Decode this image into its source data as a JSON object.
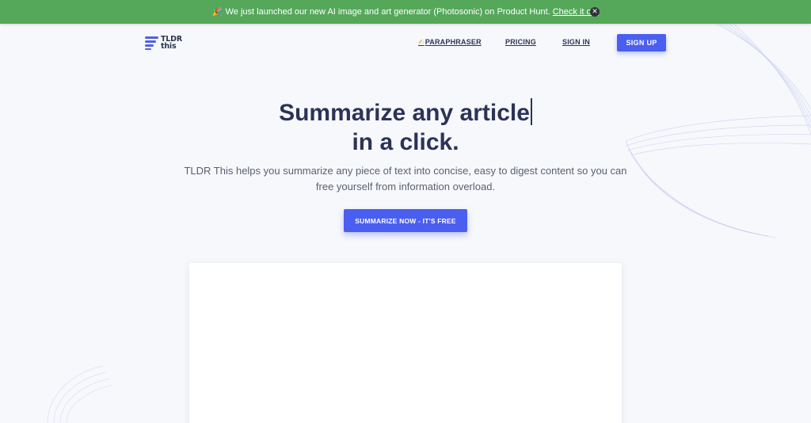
{
  "banner": {
    "emoji": "🎉",
    "text": "We just launched our new AI image and art generator (Photosonic) on Product Hunt.",
    "link_label": "Check it out",
    "close_glyph": "✕"
  },
  "logo": {
    "line1": "TLDR",
    "line2": "this",
    "icon": "lines-logo-icon",
    "color": "#5561d8"
  },
  "nav": {
    "paraphraser_icon": "✍",
    "paraphraser_label": "PARAPHRASER",
    "pricing_label": "PRICING",
    "signin_label": "SIGN IN",
    "signup_label": "SIGN UP"
  },
  "hero": {
    "title_line1": "Summarize any article",
    "title_line2": "in a click.",
    "subtitle": "TLDR This helps you summarize any piece of text into concise, easy to digest content so you can free yourself from information overload.",
    "cta_label": "SUMMARIZE NOW - IT'S FREE"
  },
  "colors": {
    "banner_green": "#55a85a",
    "accent_blue": "#4a5ef0",
    "heading_navy": "#2c3358",
    "background": "#f7f8fb"
  }
}
